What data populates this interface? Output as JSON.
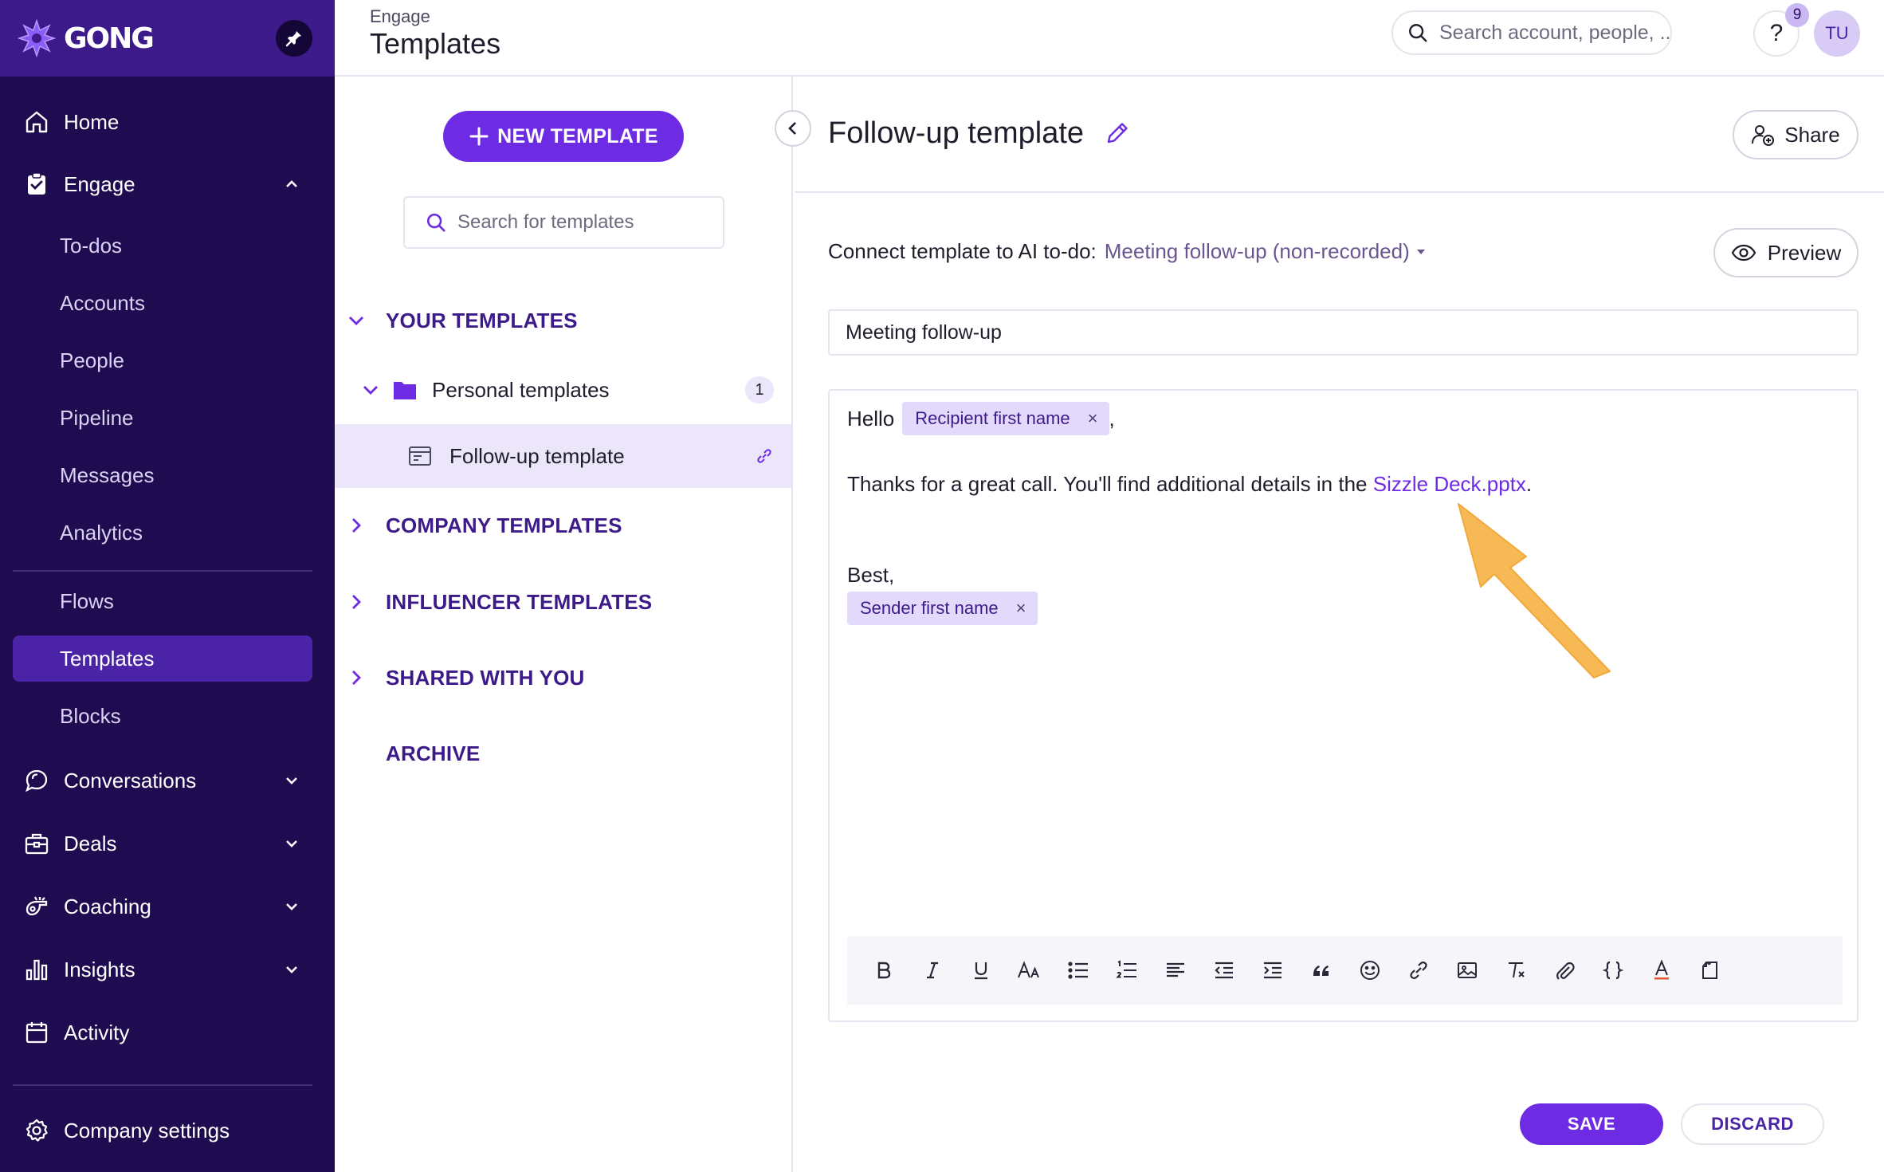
{
  "app": {
    "logo_text": "GONG"
  },
  "sidebar": {
    "items": [
      {
        "label": "Home",
        "icon": "home-icon"
      },
      {
        "label": "Engage",
        "icon": "engage-icon",
        "expanded": true
      },
      {
        "label": "To-dos"
      },
      {
        "label": "Accounts"
      },
      {
        "label": "People"
      },
      {
        "label": "Pipeline"
      },
      {
        "label": "Messages"
      },
      {
        "label": "Analytics"
      },
      {
        "label": "Flows"
      },
      {
        "label": "Templates",
        "active": true
      },
      {
        "label": "Blocks"
      },
      {
        "label": "Conversations",
        "icon": "conversations-icon"
      },
      {
        "label": "Deals",
        "icon": "briefcase-icon"
      },
      {
        "label": "Coaching",
        "icon": "coaching-icon"
      },
      {
        "label": "Insights",
        "icon": "bar-chart-icon"
      },
      {
        "label": "Activity",
        "icon": "calendar-icon"
      }
    ],
    "settings_label": "Company settings"
  },
  "header": {
    "breadcrumb": "Engage",
    "title": "Templates",
    "search_placeholder": "Search account, people, ...",
    "help_label": "?",
    "notification_count": "9",
    "avatar_initials": "TU"
  },
  "templates_panel": {
    "new_button_label": "NEW TEMPLATE",
    "search_placeholder": "Search for templates",
    "sections": {
      "your": "YOUR TEMPLATES",
      "company": "COMPANY TEMPLATES",
      "influencer": "INFLUENCER TEMPLATES",
      "shared": "SHARED WITH YOU",
      "archive": "ARCHIVE"
    },
    "folder": {
      "label": "Personal templates",
      "count": "1"
    },
    "selected_template": "Follow-up template"
  },
  "editor": {
    "title": "Follow-up template",
    "share_label": "Share",
    "connect_label": "Connect template to AI to-do:",
    "connect_value": "Meeting follow-up (non-recorded)",
    "preview_label": "Preview",
    "subject_value": "Meeting follow-up",
    "body": {
      "greeting": "Hello",
      "recipient_chip": "Recipient first name",
      "greeting_comma": ",",
      "thanks_text": "Thanks for a great call. You'll find additional details in the",
      "link_text": "Sizzle Deck.pptx",
      "period": ".",
      "signoff": "Best,",
      "sender_chip": "Sender first name",
      "chip_remove": "×"
    },
    "save_label": "SAVE",
    "discard_label": "DISCARD"
  },
  "colors": {
    "sidebar_bg": "#1f0b4f",
    "accent": "#6d2ce3",
    "selected_row": "#ece6fb",
    "annotation_arrow": "#f7b955"
  }
}
